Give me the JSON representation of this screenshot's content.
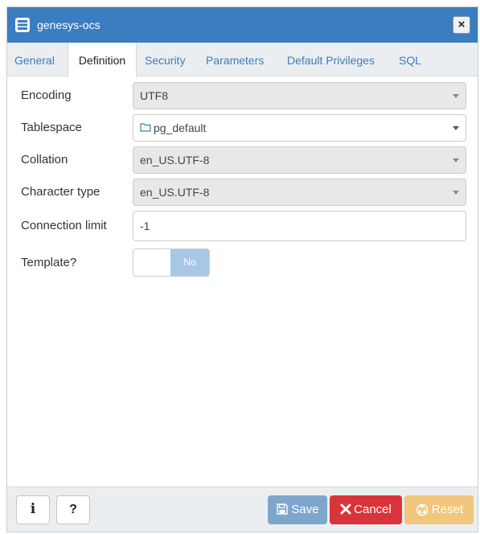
{
  "window": {
    "title": "genesys-ocs",
    "close_label": "×"
  },
  "tabs": [
    {
      "label": "General"
    },
    {
      "label": "Definition"
    },
    {
      "label": "Security"
    },
    {
      "label": "Parameters"
    },
    {
      "label": "Default Privileges"
    },
    {
      "label": "SQL"
    }
  ],
  "active_tab": "Definition",
  "form": {
    "encoding": {
      "label": "Encoding",
      "value": "UTF8"
    },
    "tablespace": {
      "label": "Tablespace",
      "value": "pg_default"
    },
    "collation": {
      "label": "Collation",
      "value": "en_US.UTF-8"
    },
    "character_type": {
      "label": "Character type",
      "value": "en_US.UTF-8"
    },
    "connection_limit": {
      "label": "Connection limit",
      "value": "-1"
    },
    "template": {
      "label": "Template?",
      "toggle_text": "No",
      "checked": false
    }
  },
  "footer": {
    "info_label": "i",
    "help_label": "?",
    "save_label": "Save",
    "cancel_label": "Cancel",
    "reset_label": "Reset"
  },
  "colors": {
    "titlebar": "#3b7dc1",
    "tab_link": "#3b7dc1",
    "save": "#7ea6cd",
    "cancel": "#d9343a",
    "reset": "#f0c77c",
    "toggle_off": "#a8c7e6"
  },
  "icons": {
    "title": "database-icon",
    "close": "close-icon",
    "tablespace": "folder-icon",
    "save": "floppy-disk-icon",
    "cancel": "x-icon",
    "reset": "recycle-icon"
  }
}
